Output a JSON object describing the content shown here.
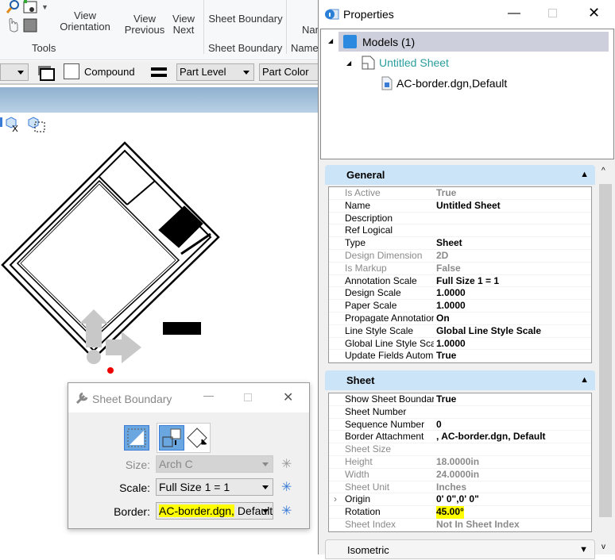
{
  "ribbon": {
    "view_orientation": "View Orientation",
    "view_previous": "View Previous",
    "view_next": "View Next",
    "sheet_boundary_btn": "Sheet Boundary",
    "name_partial": "Nam",
    "groups": [
      "Tools",
      "Sheet Boundary",
      "Name"
    ]
  },
  "toolbar2": {
    "compound": "Compound",
    "level": "Part Level",
    "color": "Part Color"
  },
  "properties": {
    "title": "Properties",
    "tree": {
      "root": "Models (1)",
      "sheet": "Untitled Sheet",
      "attachment": "AC-border.dgn,Default"
    },
    "general": {
      "header": "General",
      "rows": [
        {
          "k": "Is Active",
          "v": "True",
          "disabled": true
        },
        {
          "k": "Name",
          "v": "Untitled Sheet"
        },
        {
          "k": "Description",
          "v": ""
        },
        {
          "k": "Ref Logical",
          "v": ""
        },
        {
          "k": "Type",
          "v": "Sheet"
        },
        {
          "k": "Design Dimension",
          "v": "2D",
          "disabled": true
        },
        {
          "k": "Is Markup",
          "v": "False",
          "disabled": true
        },
        {
          "k": "Annotation Scale",
          "v": "Full Size 1 = 1"
        },
        {
          "k": "Design Scale",
          "v": "1.0000"
        },
        {
          "k": "Paper Scale",
          "v": "1.0000"
        },
        {
          "k": "Propagate Annotation",
          "v": "On"
        },
        {
          "k": "Line Style Scale",
          "v": "Global Line Style Scale"
        },
        {
          "k": "Global Line Style Scale",
          "v": "1.0000"
        },
        {
          "k": "Update Fields Automatically",
          "v": "True"
        }
      ]
    },
    "sheet": {
      "header": "Sheet",
      "rows": [
        {
          "k": "Show Sheet Boundary",
          "v": "True"
        },
        {
          "k": "Sheet Number",
          "v": ""
        },
        {
          "k": "Sequence Number",
          "v": "0"
        },
        {
          "k": "Border Attachment",
          "v": ", AC-border.dgn, Default"
        },
        {
          "k": "Sheet Size",
          "v": "",
          "disabled": true
        },
        {
          "k": "Height",
          "v": "18.0000in",
          "disabled": true
        },
        {
          "k": "Width",
          "v": "24.0000in",
          "disabled": true
        },
        {
          "k": "Sheet Unit",
          "v": "Inches",
          "disabled": true
        },
        {
          "k": "Origin",
          "v": "0' 0\",0' 0\"",
          "expandable": true
        },
        {
          "k": "Rotation",
          "v": "45.00°",
          "highlight": true
        },
        {
          "k": "Sheet Index",
          "v": "Not In Sheet Index",
          "disabled": true
        }
      ]
    },
    "isometric": {
      "header": "Isometric"
    }
  },
  "dialog": {
    "title": "Sheet Boundary",
    "size_label": "Size:",
    "size_value": "Arch C",
    "scale_label": "Scale:",
    "scale_value": "Full Size 1 = 1",
    "border_label": "Border:",
    "border_value_hl": "AC-border.dgn,",
    "border_value_rest": " Default"
  },
  "colors": {
    "highlight": "#ffff00",
    "section_header": "#cce4f7",
    "tree_link": "#2a9d9d",
    "selected_tool": "#6aa6e0"
  }
}
